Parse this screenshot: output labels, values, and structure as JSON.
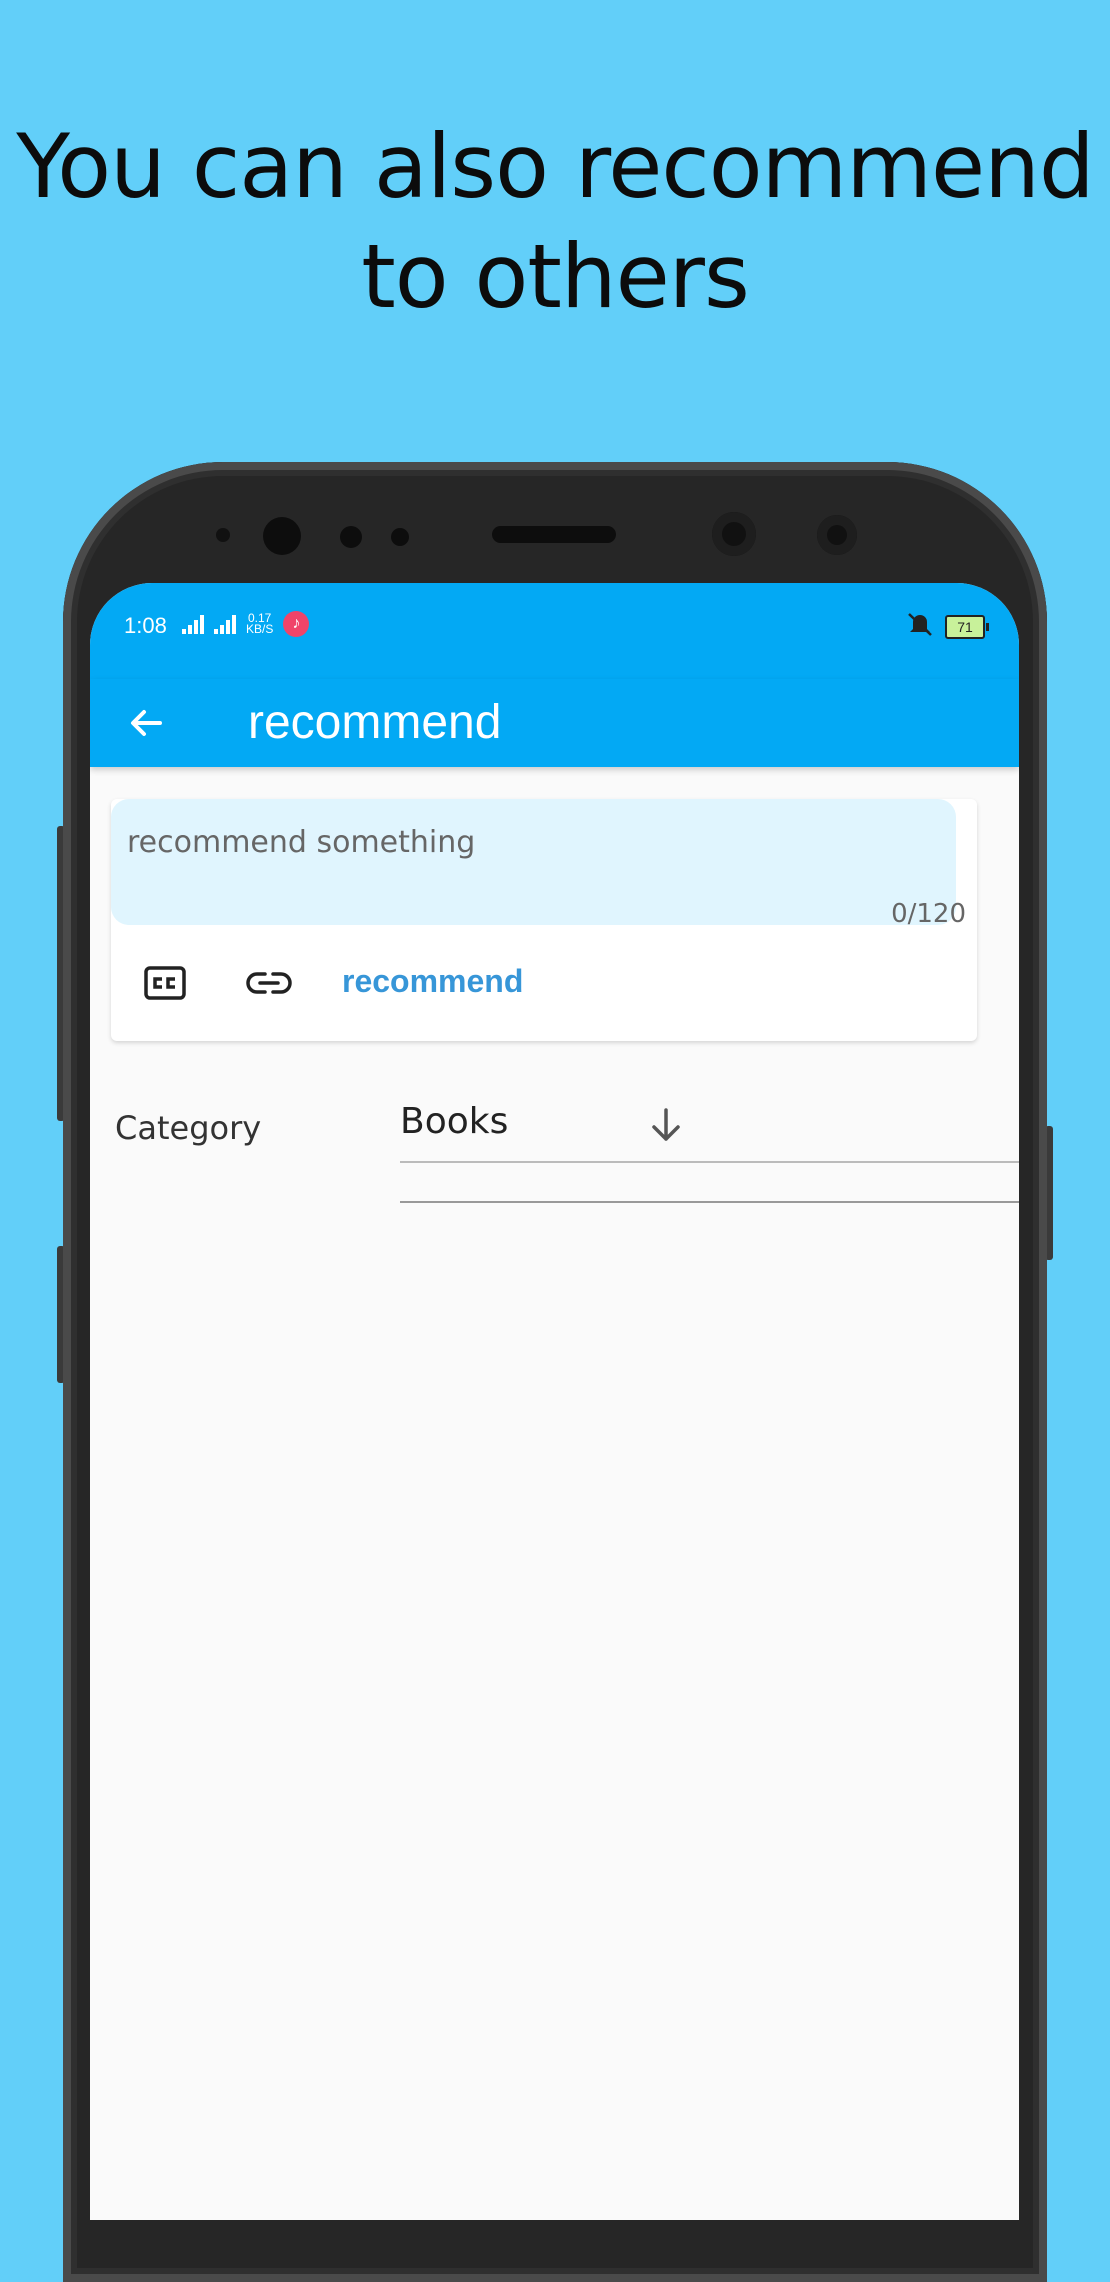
{
  "headline": {
    "line1": "You can also recommend",
    "line2": "to others"
  },
  "status_bar": {
    "time": "1:08",
    "speed_value": "0.17",
    "speed_unit": "KB/S",
    "battery": "71",
    "icons": [
      "signal-icon",
      "signal-icon",
      "music-icon",
      "mute-icon",
      "battery-icon"
    ]
  },
  "app_bar": {
    "title": "recommend",
    "back_icon": "arrow-left-icon"
  },
  "compose": {
    "placeholder": "recommend something",
    "value": "",
    "counter": "0/120",
    "tools": [
      "closed-caption-icon",
      "link-icon"
    ],
    "action_label": "recommend"
  },
  "category": {
    "label": "Category",
    "selected": "Books",
    "arrow_icon": "arrow-down-icon"
  },
  "colors": {
    "background": "#62cff9",
    "primary": "#03a9f4",
    "accent": "#3796d8",
    "input_bg": "#e0f5fe"
  }
}
